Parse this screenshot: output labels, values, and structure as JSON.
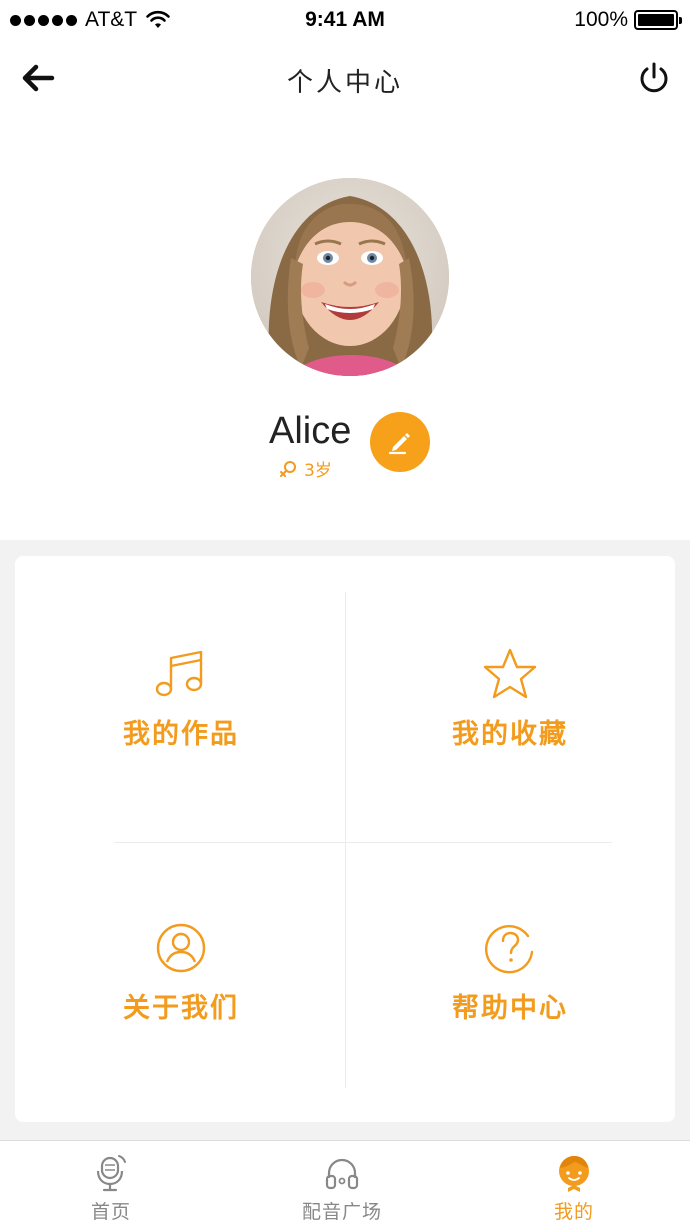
{
  "status_bar": {
    "carrier": "AT&T",
    "time": "9:41 AM",
    "battery": "100%"
  },
  "nav": {
    "title": "个人中心",
    "back_icon": "back-arrow-icon",
    "power_icon": "power-icon"
  },
  "profile": {
    "name": "Alice",
    "gender_icon": "female-icon",
    "age": "3岁",
    "edit_icon": "pencil-icon"
  },
  "menu": {
    "items": [
      {
        "label": "我的作品",
        "icon": "music-note-icon"
      },
      {
        "label": "我的收藏",
        "icon": "star-icon"
      },
      {
        "label": "关于我们",
        "icon": "user-circle-icon"
      },
      {
        "label": "帮助中心",
        "icon": "question-circle-icon"
      }
    ]
  },
  "tab_bar": {
    "tabs": [
      {
        "label": "首页",
        "icon": "microphone-icon",
        "active": false
      },
      {
        "label": "配音广场",
        "icon": "headphones-icon",
        "active": false
      },
      {
        "label": "我的",
        "icon": "kid-face-icon",
        "active": true
      }
    ]
  },
  "colors": {
    "accent": "#f29b1d",
    "accent_button": "#f7a01a",
    "background_gray": "#f2f2f2",
    "inactive_tab": "#888888"
  }
}
